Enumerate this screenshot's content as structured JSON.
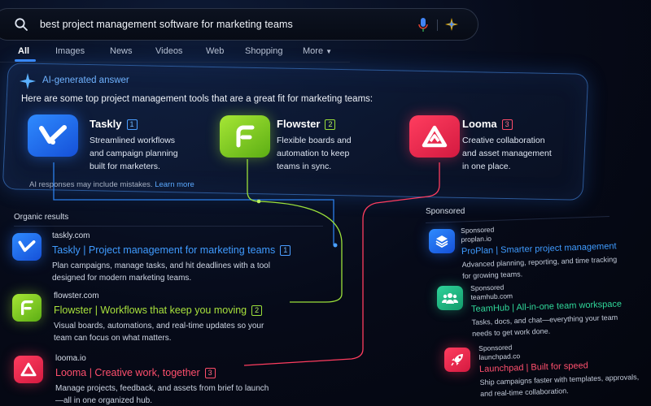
{
  "search": {
    "query": "best project management software for marketing teams"
  },
  "tabs": [
    {
      "label": "All",
      "active": true
    },
    {
      "label": "Images",
      "active": false
    },
    {
      "label": "News",
      "active": false
    },
    {
      "label": "Videos",
      "active": false
    },
    {
      "label": "Web",
      "active": false
    },
    {
      "label": "Shopping",
      "active": false
    },
    {
      "label": "More",
      "active": false
    }
  ],
  "ai_answer": {
    "title": "AI-generated answer",
    "intro": "Here are some top project management tools that are a great fit for marketing teams:",
    "tools": [
      {
        "name": "Taskly",
        "ref": "1",
        "desc": [
          "Streamlined workflows",
          "and campaign planning",
          "built for marketers."
        ],
        "color": "#2f8bff",
        "icon": "taskly-logo-icon"
      },
      {
        "name": "Flowster",
        "ref": "2",
        "desc": [
          "Flexible boards and",
          "automation to keep",
          "teams in sync."
        ],
        "color": "#9be03a",
        "icon": "flowster-logo-icon"
      },
      {
        "name": "Looma",
        "ref": "3",
        "desc": [
          "Creative collaboration",
          "and asset management",
          "in one place."
        ],
        "color": "#ff3d5f",
        "icon": "looma-logo-icon"
      }
    ],
    "disclaimer": "AI responses may include mistakes.",
    "learn_more": "Learn more"
  },
  "organic": {
    "label": "Organic results",
    "results": [
      {
        "url": "taskly.com",
        "title": "Taskly | Project management for marketing teams",
        "ref": "1",
        "desc": [
          "Plan campaigns, manage tasks, and hit deadlines with a tool",
          "designed for modern marketing teams."
        ]
      },
      {
        "url": "flowster.com",
        "title": "Flowster | Workflows that keep you moving",
        "ref": "2",
        "desc": [
          "Visual boards, automations, and real-time updates so your",
          "team can focus on what matters."
        ]
      },
      {
        "url": "looma.io",
        "title": "Looma | Creative work, together",
        "ref": "3",
        "desc": [
          "Manage projects, feedback, and assets from brief to launch",
          "—all in one organized hub."
        ]
      }
    ]
  },
  "sponsored": {
    "label": "Sponsored",
    "ads": [
      {
        "tag": "Sponsored",
        "url": "proplan.io",
        "title": "ProPlan | Smarter project management",
        "desc": [
          "Advanced planning, reporting, and time tracking",
          "for growing teams."
        ],
        "icon": "layers-icon"
      },
      {
        "tag": "Sponsored",
        "url": "teamhub.com",
        "title": "TeamHub | All-in-one team workspace",
        "desc": [
          "Tasks, docs, and chat—everything your team",
          "needs to get work done."
        ],
        "icon": "people-icon"
      },
      {
        "tag": "Sponsored",
        "url": "launchpad.co",
        "title": "Launchpad | Built for speed",
        "desc": [
          "Ship campaigns faster with templates, approvals,",
          "and real-time collaboration."
        ],
        "icon": "rocket-icon"
      }
    ]
  },
  "colors": {
    "accent_blue": "#3b8cff",
    "flowster_green": "#9be03a",
    "looma_red": "#ff3d5f",
    "teamhub_green": "#30d89a"
  }
}
